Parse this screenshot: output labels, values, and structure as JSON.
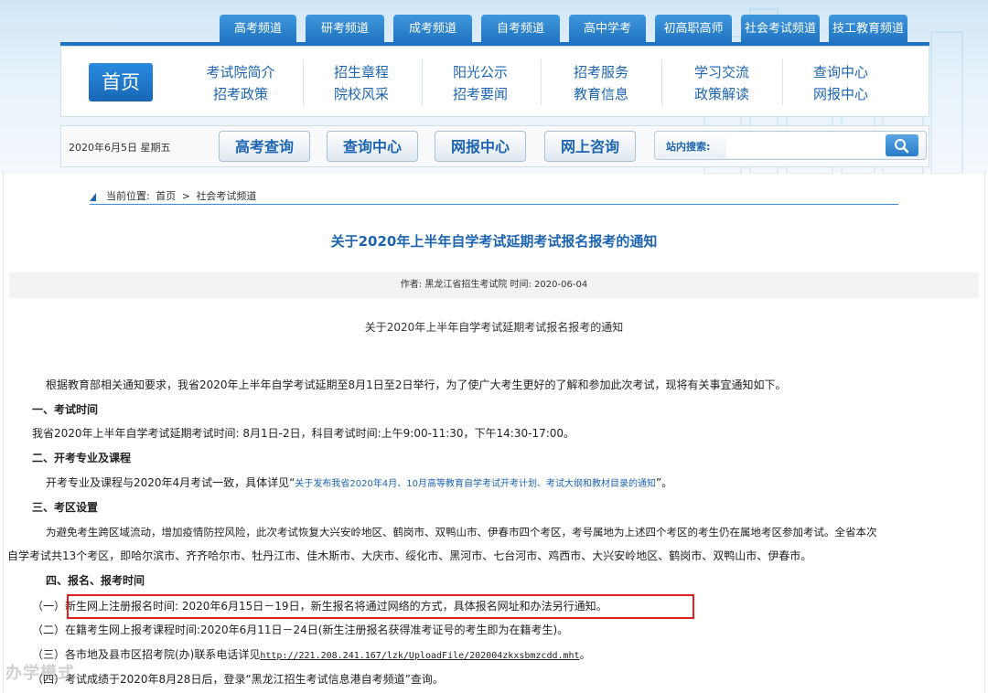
{
  "channels": [
    "高考频道",
    "研考频道",
    "成考频道",
    "自考频道",
    "高中学考",
    "初高职高师",
    "社会考试频道",
    "技工教育频道"
  ],
  "nav": {
    "home": "首页",
    "columns": [
      {
        "top": "考试院简介",
        "bottom": "招考政策"
      },
      {
        "top": "招生章程",
        "bottom": "院校风采"
      },
      {
        "top": "阳光公示",
        "bottom": "招考要闻"
      },
      {
        "top": "招考服务",
        "bottom": "教育信息"
      },
      {
        "top": "学习交流",
        "bottom": "政策解读"
      },
      {
        "top": "查询中心",
        "bottom": "网报中心"
      }
    ]
  },
  "toolbar": {
    "date": "2020年6月5日 星期五",
    "buttons": [
      "高考查询",
      "查询中心",
      "网报中心",
      "网上咨询"
    ],
    "search_label": "站内搜索:",
    "search_placeholder": ""
  },
  "breadcrumb": {
    "prefix": "当前位置:",
    "home": "首页",
    "separator": ">",
    "current": "社会考试频道"
  },
  "article": {
    "title": "关于2020年上半年自学考试延期考试报名报考的通知",
    "meta": "作者: 黑龙江省招生考试院 时间: 2020-06-04",
    "subtitle": "关于2020年上半年自学考试延期考试报名报考的通知",
    "intro": "根据教育部相关通知要求，我省2020年上半年自学考试延期至8月1日至2日举行，为了使广大考生更好的了解和参加此次考试，现将有关事宜通知如下。",
    "s1_title": "一、考试时间",
    "s1_body": "我省2020年上半年自学考试延期考试时间: 8月1日-2日，科目考试时间:上午9:00-11:30，下午14:30-17:00。",
    "s2_title": "二、开考专业及课程",
    "s2_body_pre": "开考专业及课程与2020年4月考试一致，具体详见“",
    "s2_link": "关于发布我省2020年4月、10月高等教育自学考试开考计划、考试大纲和教材目录的通知",
    "s2_body_post": "”。",
    "s3_title": "三、考区设置",
    "s3_body_1": "为避免考生跨区域流动，增加疫情防控风险，此次考试恢复大兴安岭地区、鹤岗市、双鸭山市、伊春市四个考区，考号属地为上述四个考区的考生仍在属地考区参加考试。全省本次",
    "s3_body_2": "自学考试共13个考区，即哈尔滨市、齐齐哈尔市、牡丹江市、佳木斯市、大庆市、绥化市、黑河市、七台河市、鸡西市、大兴安岭地区、鹤岗市、双鸭山市、伊春市。",
    "s4_title": "四、报名、报考时间",
    "s4_item1": "（一）新生网上注册报名时间: 2020年6月15日－19日，新生报名将通过网络的方式，具体报名网址和办法另行通知。",
    "s4_item2": "（二）在籍考生网上报考课程时间:2020年6月11日－24日(新生注册报名获得准考证号的考生即为在籍考生)。",
    "s4_item3_pre": "（三）各市地及县市区招考院(办)联系电话详见",
    "s4_item3_url": "http://221.208.241.167/lzk/UploadFile/202004zkxsbmzcdd.mht",
    "s4_item3_post": "。",
    "s4_item4": "（四）考试成绩于2020年8月28日后，登录“黑龙江招生考试信息港自考频道”查询。"
  },
  "watermark": "办学模式"
}
